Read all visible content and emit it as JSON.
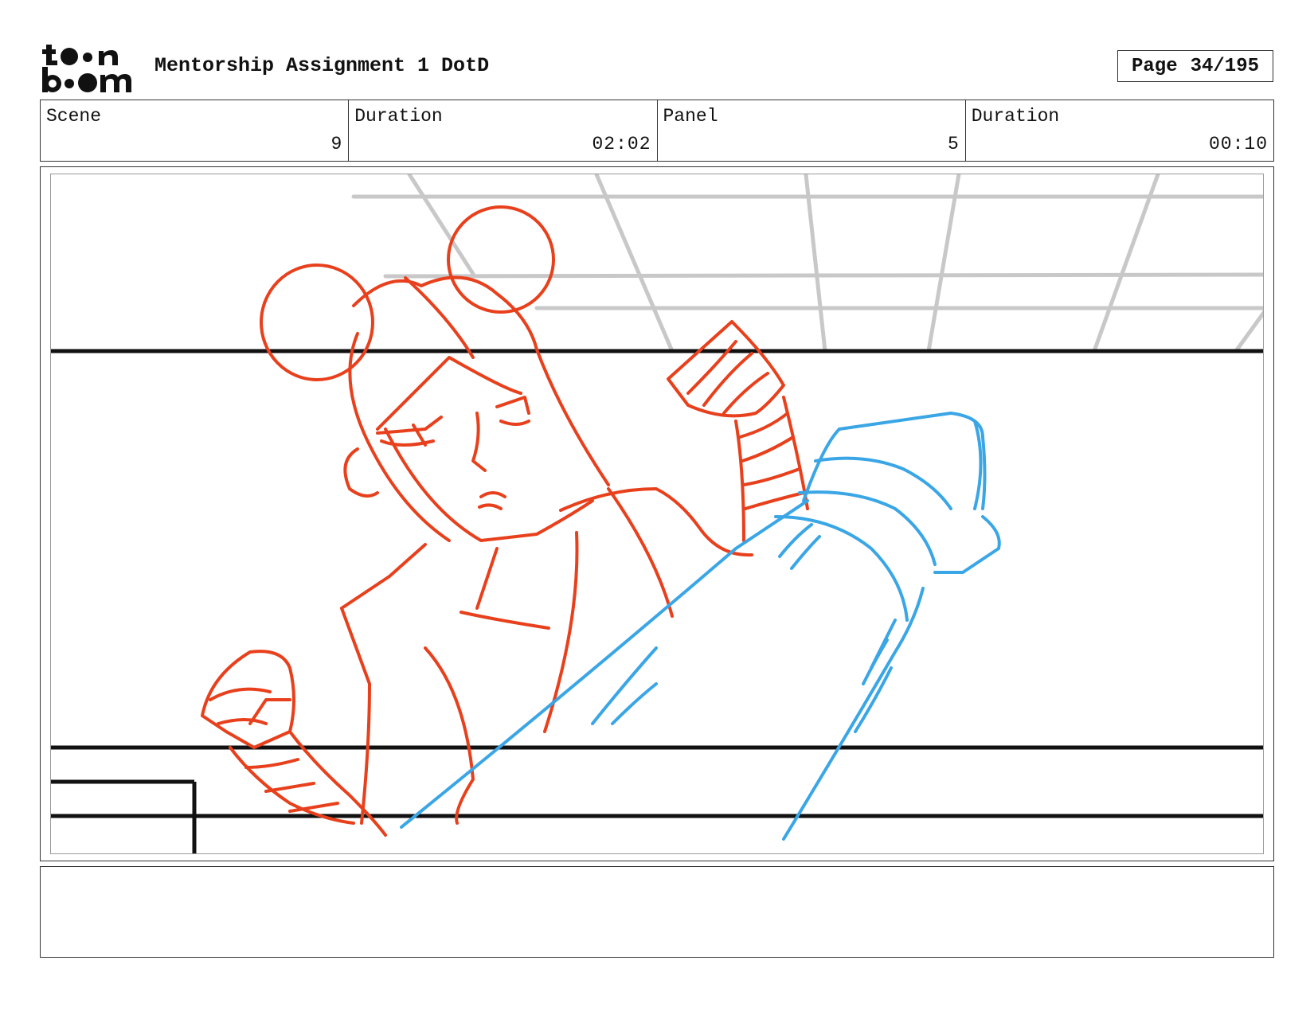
{
  "header": {
    "logo_text": "toon boom",
    "title": "Mentorship Assignment 1 DotD",
    "page_label": "Page",
    "page_value": "34/195"
  },
  "info": [
    {
      "label": "Scene",
      "value": "9"
    },
    {
      "label": "Duration",
      "value": "02:02"
    },
    {
      "label": "Panel",
      "value": "5"
    },
    {
      "label": "Duration",
      "value": "00:10"
    }
  ],
  "panel": {
    "description": "",
    "colors": {
      "character_sketch": "#e8401c",
      "leg_sketch": "#3aa6e6",
      "ceiling_grid": "#c8c8c8",
      "background_lines": "#111111"
    }
  },
  "notes": {
    "text": ""
  }
}
